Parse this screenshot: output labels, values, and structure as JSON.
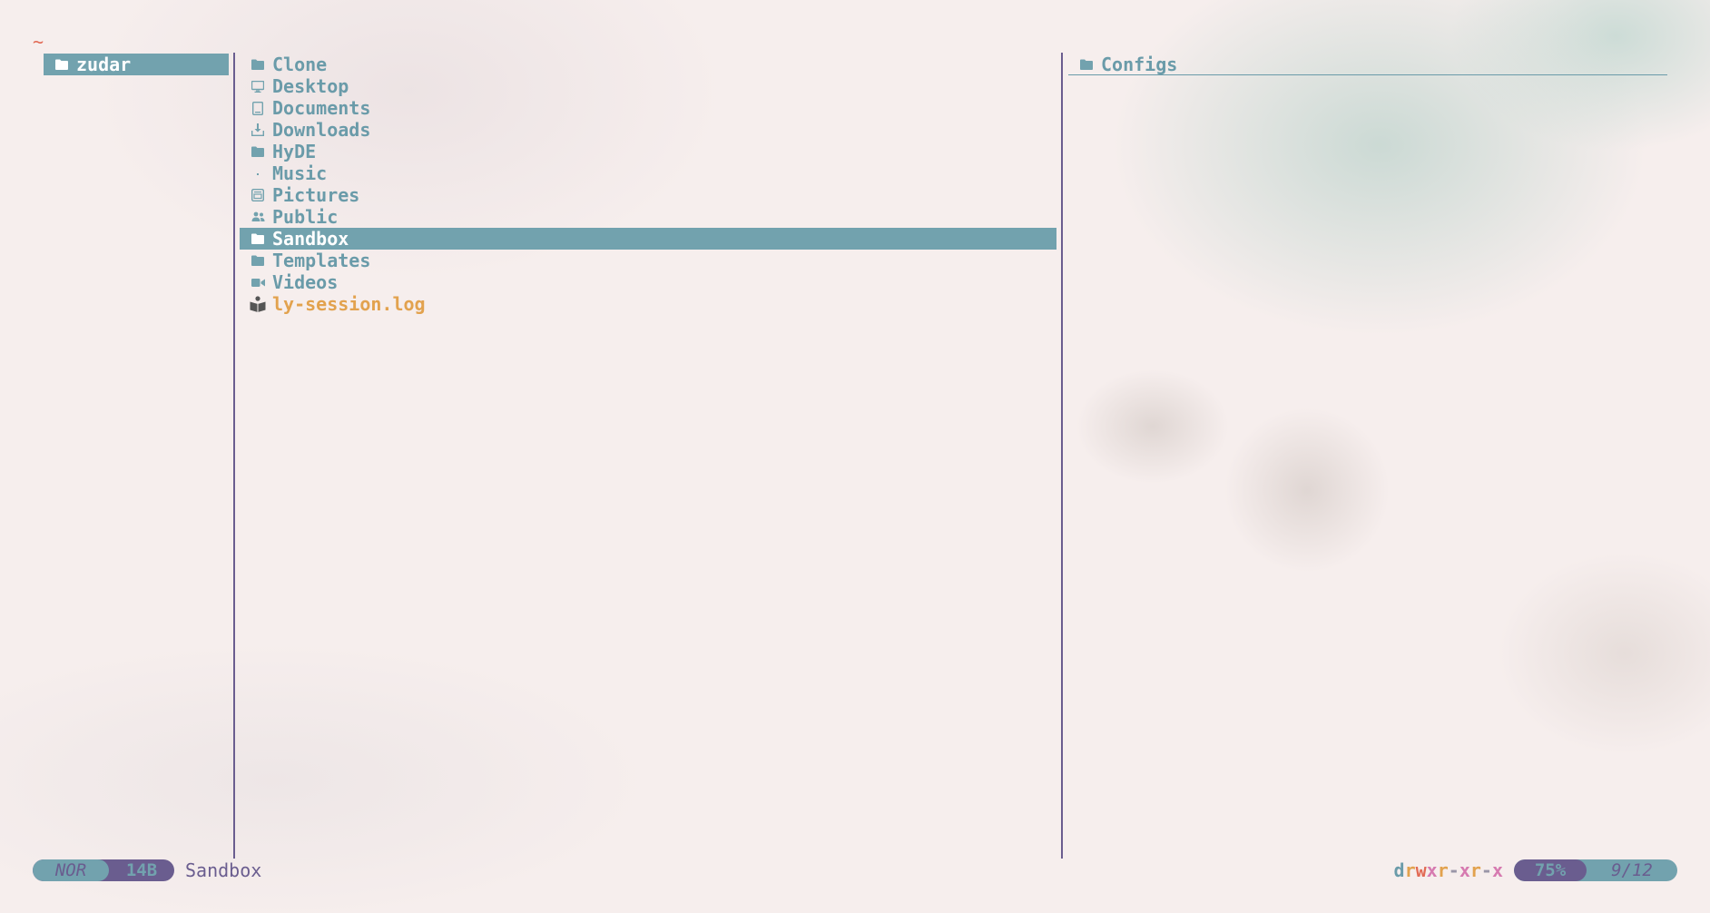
{
  "app": {
    "cwd": "~",
    "accent": "#72a2ae",
    "secondary": "#6a5d8f",
    "file_color": "#e2a24e"
  },
  "parent": {
    "items": [
      {
        "name": "zudar",
        "icon": "folder-icon",
        "selected": true
      }
    ]
  },
  "current": {
    "items": [
      {
        "name": "Clone",
        "icon": "folder-icon"
      },
      {
        "name": "Desktop",
        "icon": "desktop-icon"
      },
      {
        "name": "Documents",
        "icon": "documents-icon"
      },
      {
        "name": "Downloads",
        "icon": "downloads-icon"
      },
      {
        "name": "HyDE",
        "icon": "folder-icon"
      },
      {
        "name": "Music",
        "icon": "music-icon"
      },
      {
        "name": "Pictures",
        "icon": "pictures-icon"
      },
      {
        "name": "Public",
        "icon": "public-icon"
      },
      {
        "name": "Sandbox",
        "icon": "folder-icon",
        "selected": true
      },
      {
        "name": "Templates",
        "icon": "folder-icon"
      },
      {
        "name": "Videos",
        "icon": "videos-icon"
      },
      {
        "name": "ly-session.log",
        "icon": "log-file-icon",
        "file": true
      }
    ]
  },
  "preview": {
    "items": [
      {
        "name": "Configs",
        "icon": "folder-icon"
      }
    ]
  },
  "status": {
    "mode": "NOR",
    "size": "14B",
    "name": "Sandbox",
    "permissions": [
      {
        "c": "d",
        "color": "#6a9ba9"
      },
      {
        "c": "r",
        "color": "#e2a24e"
      },
      {
        "c": "w",
        "color": "#e26a55"
      },
      {
        "c": "x",
        "color": "#d67ab0"
      },
      {
        "c": "r",
        "color": "#e2a24e"
      },
      {
        "c": "-",
        "color": "#9a96a8"
      },
      {
        "c": "x",
        "color": "#d67ab0"
      },
      {
        "c": "r",
        "color": "#e2a24e"
      },
      {
        "c": "-",
        "color": "#9a96a8"
      },
      {
        "c": "x",
        "color": "#d67ab0"
      }
    ],
    "percent": "75%",
    "position": "9/12"
  }
}
